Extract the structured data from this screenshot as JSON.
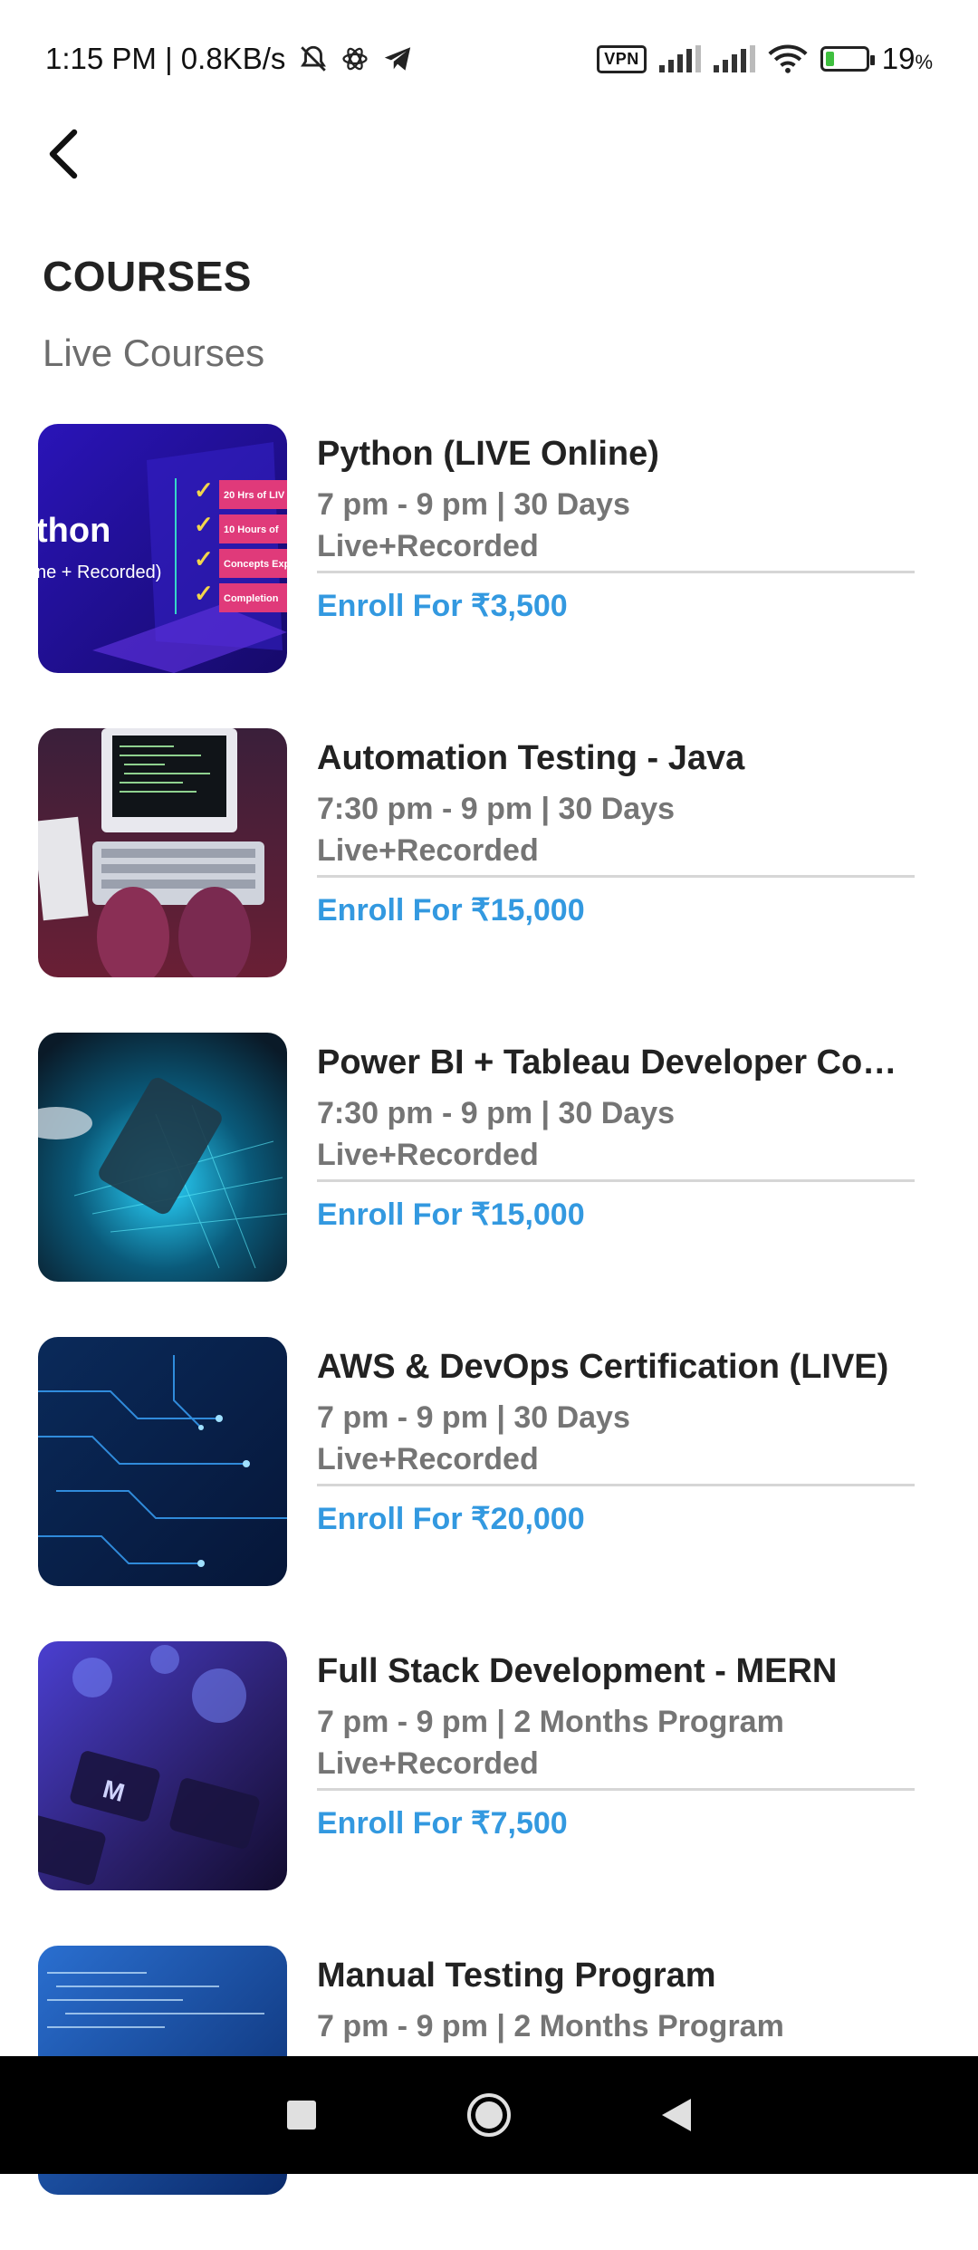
{
  "status_bar": {
    "time_speed": "1:15 PM | 0.8KB/s",
    "vpn": "VPN",
    "battery_pct": "19",
    "battery_unit": "%"
  },
  "header": {
    "back_icon": "arrow-back-icon"
  },
  "page": {
    "title": "COURSES",
    "section": "Live Courses"
  },
  "courses": [
    {
      "title": "Python (LIVE Online)",
      "schedule": "7 pm - 9 pm | 30 Days",
      "mode": "Live+Recorded",
      "enroll": "Enroll For ₹3,500",
      "thumb": {
        "heading": "thon",
        "sub": "ne + Recorded)",
        "items": [
          "20 Hrs of LIV",
          "10 Hours of",
          "Concepts Exp",
          "Completion"
        ]
      }
    },
    {
      "title": "Automation Testing - Java",
      "schedule": "7:30 pm - 9 pm | 30 Days",
      "mode": "Live+Recorded",
      "enroll": "Enroll For ₹15,000"
    },
    {
      "title": "Power BI + Tableau Developer Cou…",
      "schedule": "7:30 pm - 9 pm | 30 Days",
      "mode": "Live+Recorded",
      "enroll": "Enroll For ₹15,000"
    },
    {
      "title": "AWS & DevOps Certification (LIVE)",
      "schedule": "7 pm - 9 pm | 30 Days",
      "mode": "Live+Recorded",
      "enroll": "Enroll For ₹20,000"
    },
    {
      "title": "Full Stack Development - MERN",
      "schedule": "7 pm - 9 pm | 2 Months Program",
      "mode": "Live+Recorded",
      "enroll": "Enroll For ₹7,500"
    },
    {
      "title": "Manual Testing Program",
      "schedule": "7 pm - 9 pm | 2 Months Program",
      "mode": "",
      "enroll": ""
    }
  ],
  "colors": {
    "accent": "#3399e0",
    "title": "#222222",
    "muted": "#757575",
    "divider": "#d6d6d6"
  },
  "nav": {
    "recents": "square-recents-icon",
    "home": "circle-home-icon",
    "back": "triangle-back-icon"
  }
}
